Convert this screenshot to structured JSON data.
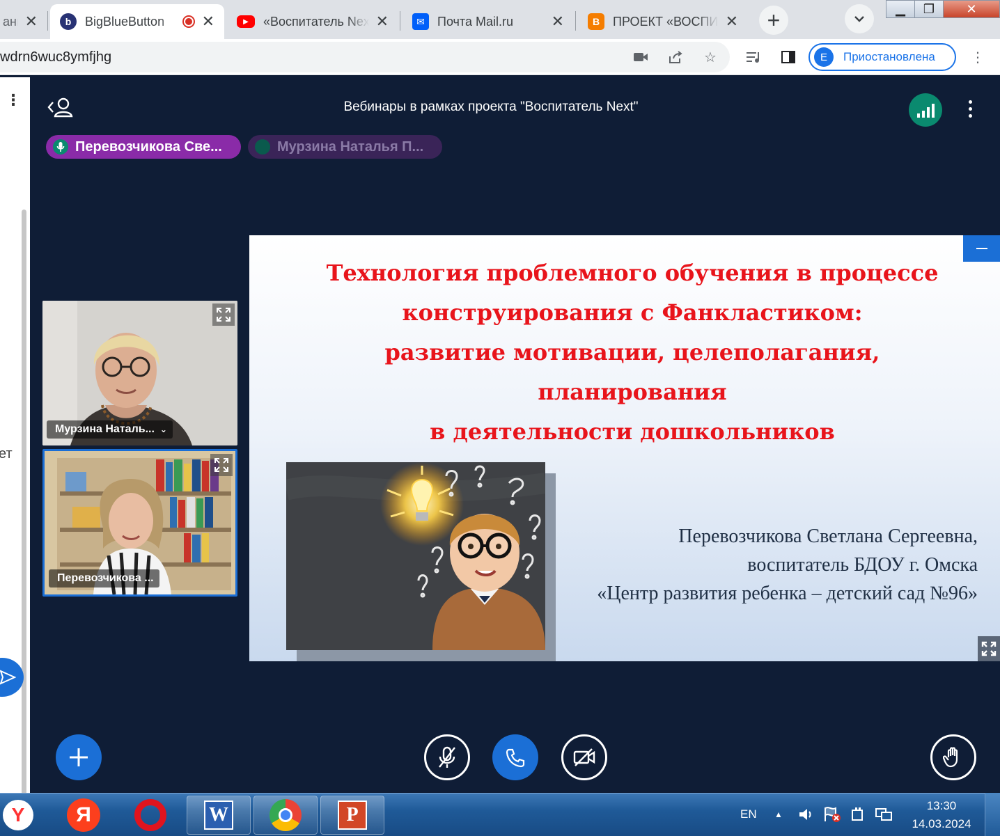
{
  "browser": {
    "tabs": [
      {
        "title": "ание",
        "favicon": "page-icon"
      },
      {
        "title": "BigBlueButton",
        "favicon": "bbb-icon",
        "recording": true
      },
      {
        "title": "«Воспитатель Next»",
        "favicon": "youtube-icon"
      },
      {
        "title": "Почта Mail.ru",
        "favicon": "mail-icon"
      },
      {
        "title": "ПРОЕКТ «ВОСПИТАТЕЛЬ",
        "favicon": "blogger-icon"
      }
    ],
    "new_tab": "+",
    "address": "wdrn6wuc8ymfjhg",
    "profile_initial": "E",
    "profile_status": "Приостановлена"
  },
  "bbb": {
    "meeting_title": "Вебинары в рамках проекта \"Воспитатель Next\"",
    "talkers": [
      {
        "name": "Перевозчикова Све..."
      },
      {
        "name": "Мурзина Наталья П..."
      }
    ],
    "webcams": [
      {
        "name": "Мурзина Наталь..."
      },
      {
        "name": "Перевозчикова ..."
      }
    ],
    "left_panel_text": "ет",
    "slide": {
      "title_lines": [
        "Технология проблемного обучения в процессе",
        "конструирования с Фанкластиком:",
        "развитие мотивации, целеполагания,",
        "планирования",
        "в деятельности дошкольников"
      ],
      "author_lines": [
        "Перевозчикова Светлана Сергеевна,",
        "воспитатель БДОУ г. Омска",
        "«Центр развития ребенка – детский сад №96»"
      ]
    }
  },
  "taskbar": {
    "lang": "EN",
    "time": "13:30",
    "date": "14.03.2024",
    "apps": [
      "yandex-browser-icon",
      "yandex-icon",
      "opera-icon",
      "word-icon",
      "chrome-icon",
      "powerpoint-icon"
    ]
  },
  "colors": {
    "bbb_bg": "#0f1d36",
    "bbb_blue": "#1b6fd6",
    "slide_title": "#e8141b",
    "talker_active": "#8a2ba8"
  }
}
